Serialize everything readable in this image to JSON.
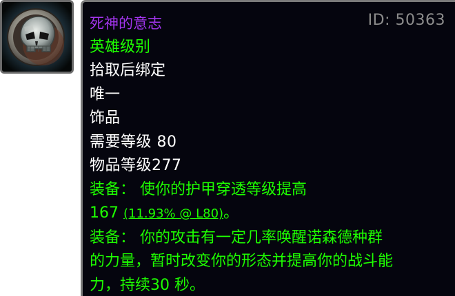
{
  "item": {
    "name": "死神的意志",
    "id_label": "ID: 50363",
    "quality": "英雄级别",
    "binding": "拾取后绑定",
    "unique": "唯一",
    "slot": "饰品",
    "required_level": "需要等级 80",
    "item_level": "物品等级277",
    "effects": {
      "armor_pen_line1": "装备： 使你的护甲穿透等级提高",
      "armor_pen_value": "167 ",
      "armor_pen_pct": "(11.93% @ L80)",
      "armor_pen_end": "。",
      "proc_line1": "装备： 你的攻击有一定几率唤醒诺森德种群",
      "proc_line2": "的力量，暂时改变你的形态并提高你的战斗能",
      "proc_line3": "力，持续30 秒。"
    }
  },
  "icon": {
    "name": "skull-trinket-icon"
  },
  "colors": {
    "epic": "#a335ee",
    "heroic_green": "#1eff00",
    "white": "#ffffff",
    "id_gray": "#8c8c8c",
    "tooltip_bg": "#05050e",
    "border": "#7a7a7a"
  }
}
